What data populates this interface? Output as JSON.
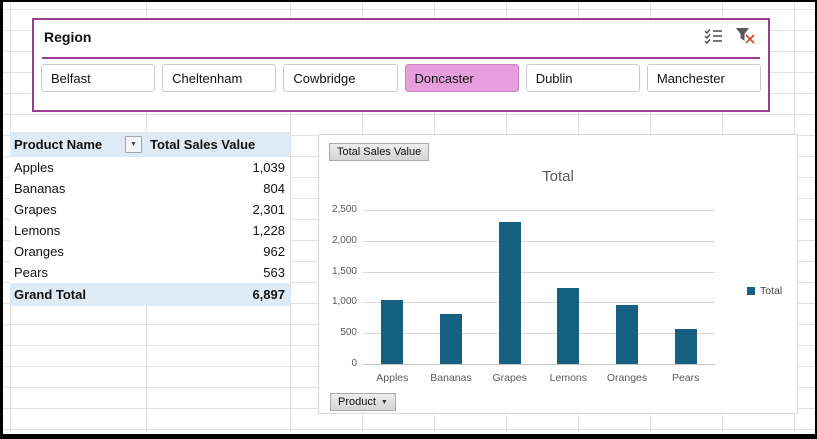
{
  "slicer": {
    "title": "Region",
    "buttons": [
      {
        "label": "Belfast",
        "selected": false
      },
      {
        "label": "Cheltenham",
        "selected": false
      },
      {
        "label": "Cowbridge",
        "selected": false
      },
      {
        "label": "Doncaster",
        "selected": true
      },
      {
        "label": "Dublin",
        "selected": false
      },
      {
        "label": "Manchester",
        "selected": false
      }
    ]
  },
  "pivot_table": {
    "columns": [
      "Product Name",
      "Total Sales Value"
    ],
    "rows": [
      {
        "product": "Apples",
        "value": "1,039"
      },
      {
        "product": "Bananas",
        "value": "804"
      },
      {
        "product": "Grapes",
        "value": "2,301"
      },
      {
        "product": "Lemons",
        "value": "1,228"
      },
      {
        "product": "Oranges",
        "value": "962"
      },
      {
        "product": "Pears",
        "value": "563"
      }
    ],
    "grand_total": {
      "product": "Grand Total",
      "value": "6,897"
    }
  },
  "chart": {
    "field_buttons": {
      "value": "Total Sales Value",
      "axis": "Product"
    },
    "legend_label": "Total"
  },
  "chart_data": {
    "type": "bar",
    "title": "Total",
    "categories": [
      "Apples",
      "Bananas",
      "Grapes",
      "Lemons",
      "Oranges",
      "Pears"
    ],
    "series": [
      {
        "name": "Total",
        "values": [
          1039,
          804,
          2301,
          1228,
          962,
          563
        ]
      }
    ],
    "ylim": [
      0,
      2500
    ],
    "ytick_step": 500,
    "ytick_labels": [
      "0",
      "500",
      "1,000",
      "1,500",
      "2,000",
      "2,500"
    ],
    "grid": "horizontal",
    "legend_position": "right"
  },
  "colors": {
    "slicer_border": "#9c3d94",
    "slicer_selected_fill": "#e79edc",
    "slicer_selected_border": "#d183c6",
    "table_header_fill": "#ddebf7",
    "bar_fill": "#166082",
    "chart_text": "#595959",
    "worksheet_gridline": "#e2e2e2",
    "chart_gridline": "#d9d9d9"
  }
}
